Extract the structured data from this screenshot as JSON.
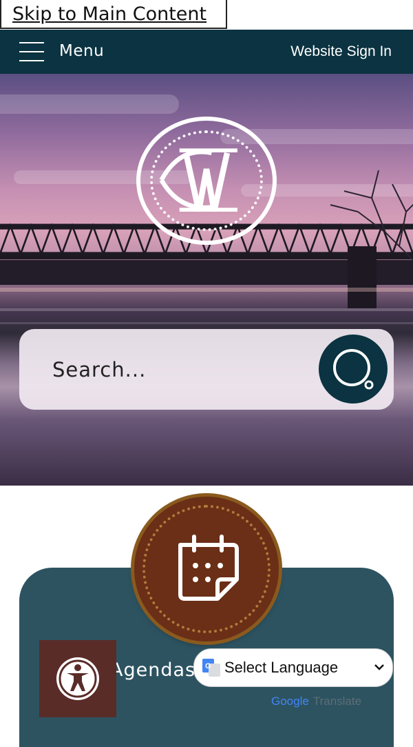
{
  "skip_link": "Skip to Main Content",
  "topbar": {
    "menu_label": "Menu",
    "signin_label": "Website Sign In"
  },
  "hero": {
    "logo_icon": "city-seal-logo-icon",
    "search": {
      "placeholder": "Search...",
      "button_icon": "search-icon"
    }
  },
  "quick_link": {
    "icon": "calendar-icon",
    "label": "Agendas"
  },
  "accessibility": {
    "icon": "accessibility-icon"
  },
  "translate": {
    "selected": "Select Language",
    "powered_by_google": "Google",
    "powered_by_translate": "Translate"
  },
  "colors": {
    "brand_dark": "#0b3341",
    "card_teal": "#2d5361",
    "badge_brown": "#6a2f16",
    "accessibility_brown": "#5a2c28"
  }
}
